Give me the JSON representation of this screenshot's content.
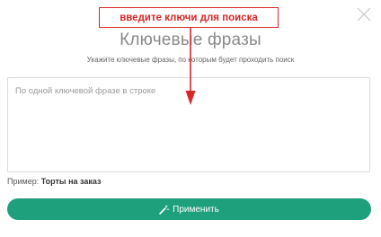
{
  "dialog": {
    "title": "Ключевые фразы",
    "subtitle": "Укажите ключевые фразы, по которым будет проходить поиск",
    "textarea_placeholder": "По одной ключевой фразе в строке",
    "textarea_value": "",
    "example_label": "Пример:",
    "example_value": "Торты на заказ",
    "apply_label": "Применить",
    "close_icon": "close-icon",
    "apply_icon": "magic-wand-icon"
  },
  "annotation": {
    "callout_text": "введите ключи для поиска"
  },
  "colors": {
    "accent": "#1ea07c",
    "callout": "#d62828",
    "title": "#8a8a8a"
  }
}
